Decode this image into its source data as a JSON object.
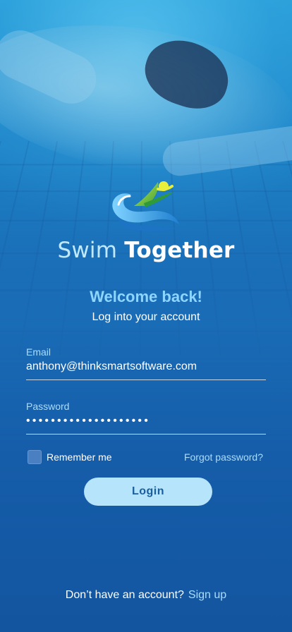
{
  "brand": {
    "name_light": "Swim",
    "name_bold": "Together"
  },
  "header": {
    "welcome": "Welcome back!",
    "subtitle": "Log into your account"
  },
  "form": {
    "email_label": "Email",
    "email_value": "anthony@thinksmartsoftware.com",
    "password_label": "Password",
    "password_value": "••••••••••••••••••••",
    "remember_label": "Remember me",
    "remember_checked": false,
    "forgot_label": "Forgot password?",
    "login_label": "Login"
  },
  "footer": {
    "question": "Don’t have an account?",
    "signup_label": "Sign up"
  },
  "colors": {
    "accent": "#8ed6ff",
    "link": "#a9dcff",
    "button_bg": "#b5e4fb",
    "button_text": "#1b5e9f"
  },
  "icons": {
    "logo": "swimmer-wave-logo"
  }
}
